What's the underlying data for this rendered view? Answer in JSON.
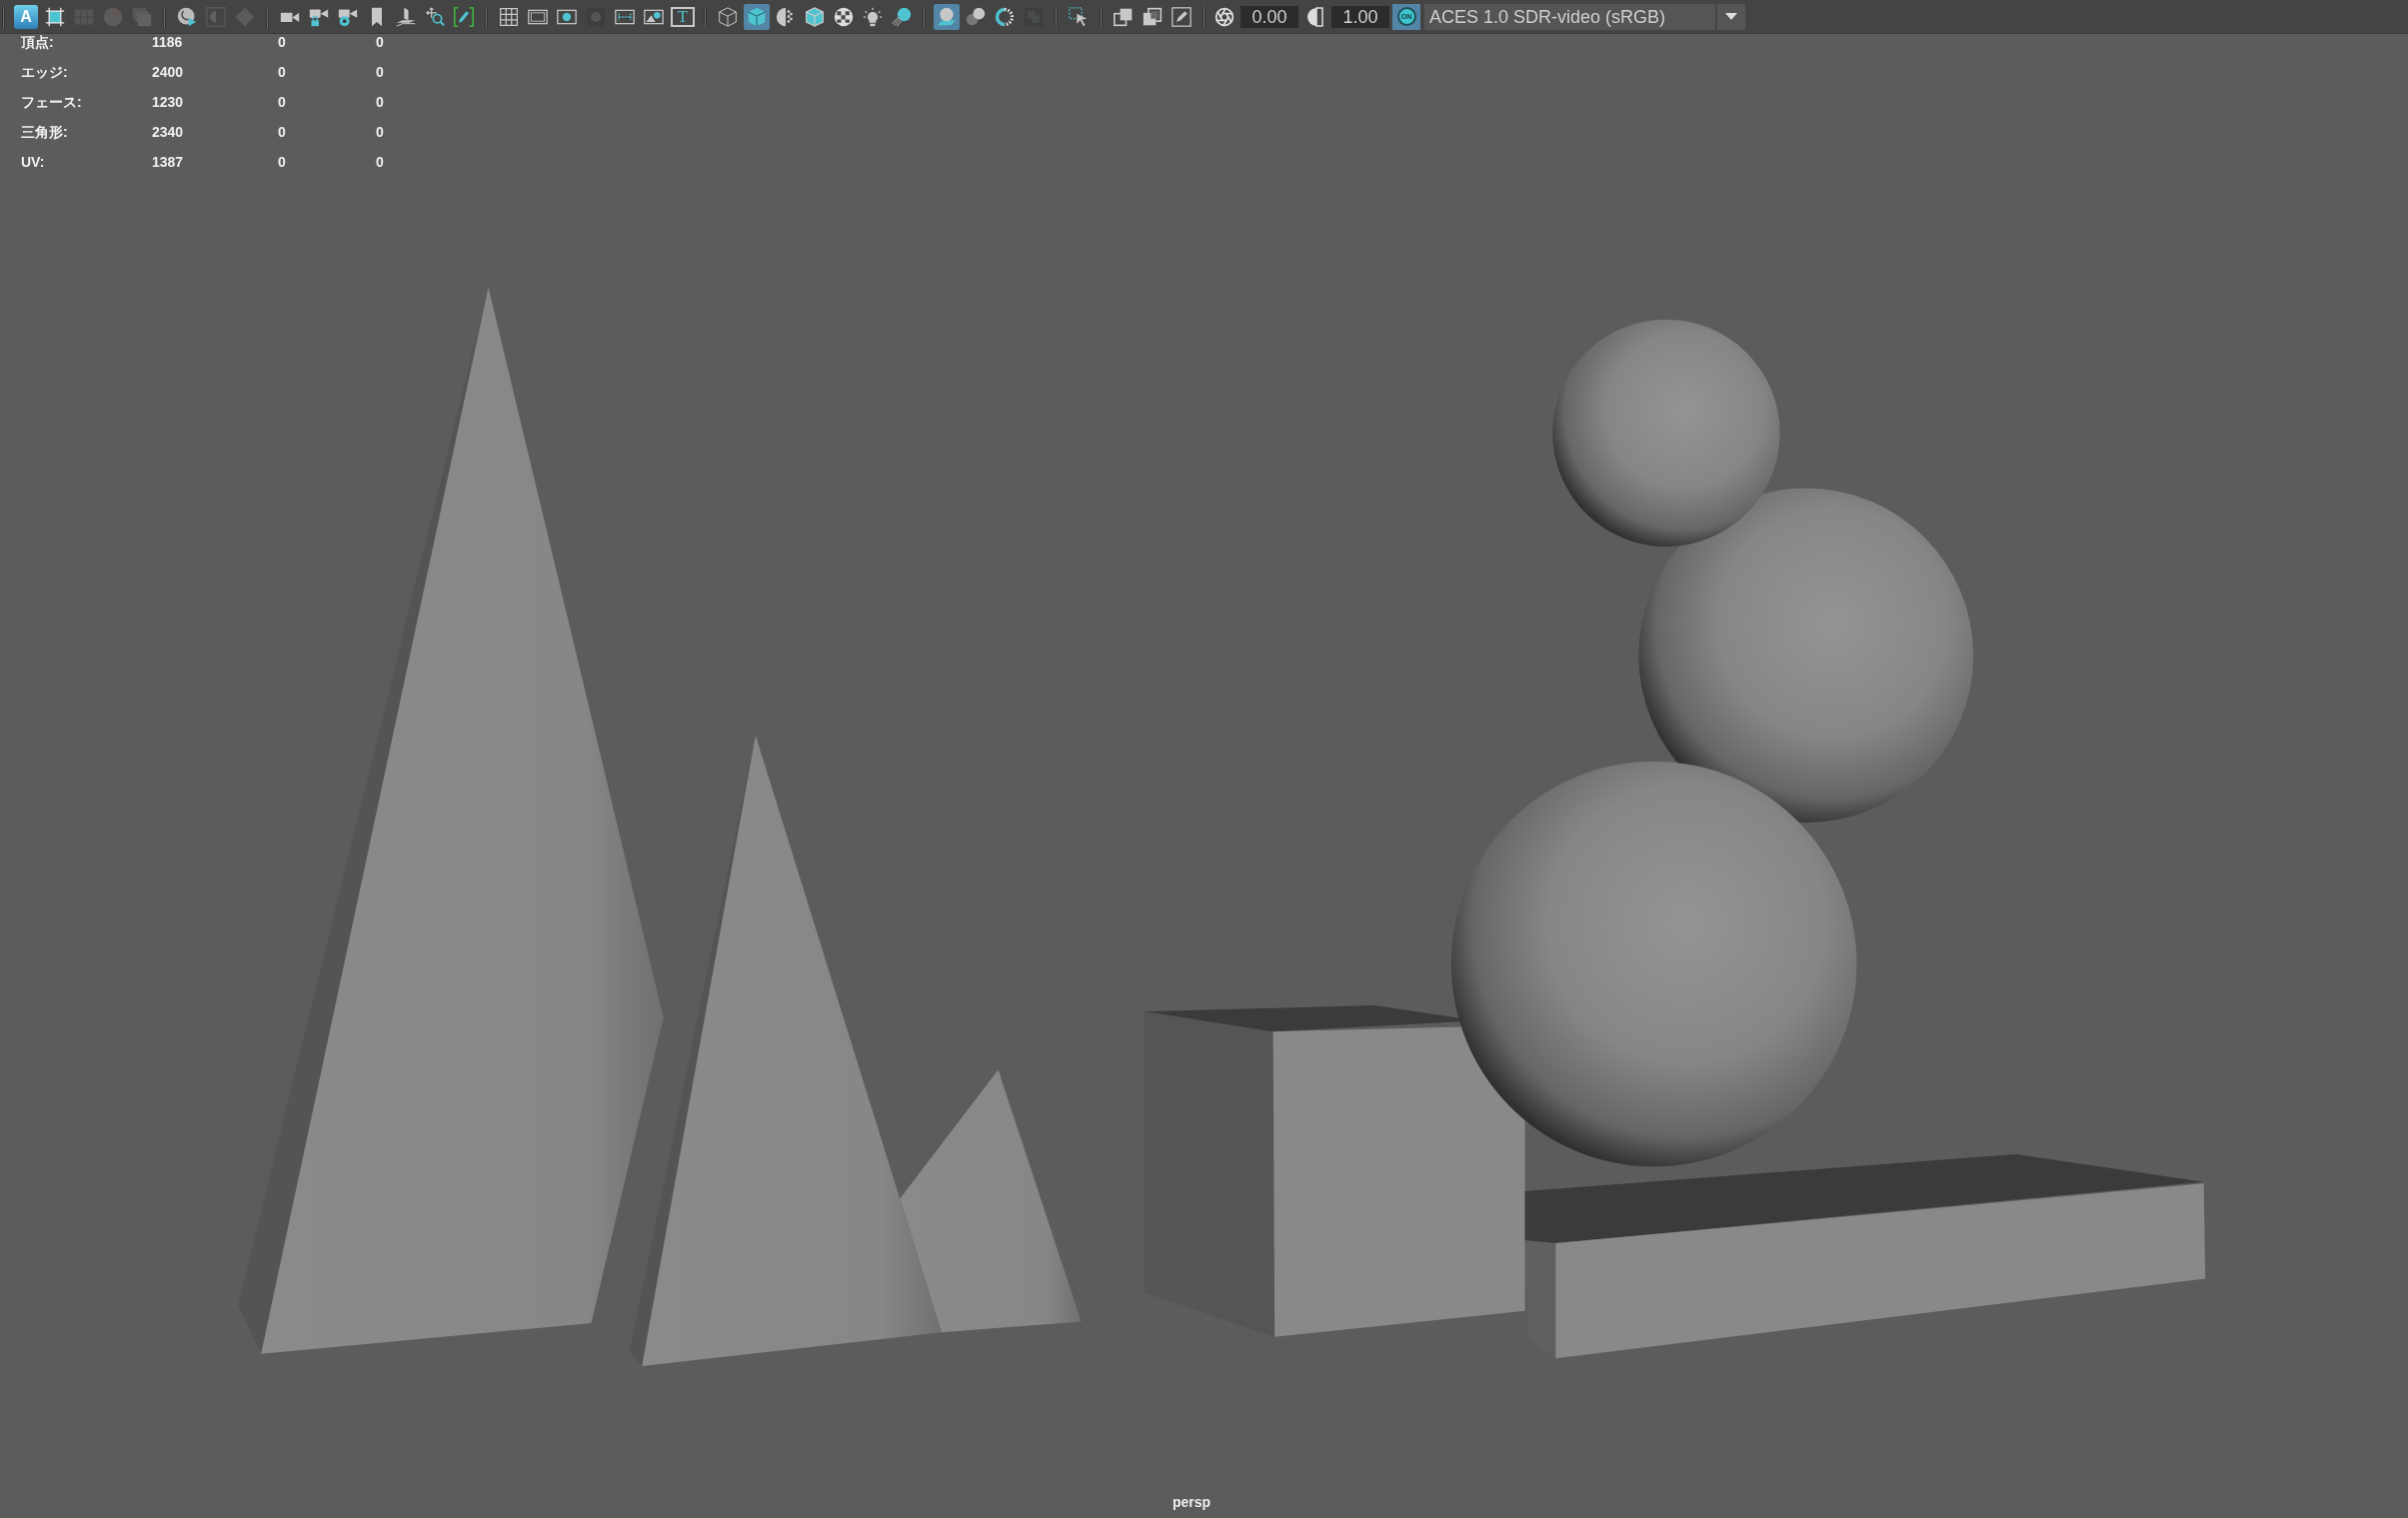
{
  "toolbar": {
    "groups": [
      {
        "buttons": [
          {
            "label": "A",
            "pressed": false,
            "disabled": false
          },
          {
            "pressed": false,
            "disabled": false
          },
          {
            "pressed": false,
            "disabled": true
          },
          {
            "pressed": false,
            "disabled": true
          },
          {
            "pressed": false,
            "disabled": true
          }
        ]
      },
      {
        "buttons": [
          {
            "pressed": false,
            "disabled": false
          },
          {
            "pressed": false,
            "disabled": true
          },
          {
            "pressed": false,
            "disabled": true
          }
        ]
      },
      {
        "buttons": [
          {
            "pressed": false,
            "disabled": false
          },
          {
            "pressed": false,
            "disabled": false
          },
          {
            "pressed": false,
            "disabled": false
          },
          {
            "pressed": false,
            "disabled": false
          },
          {
            "pressed": false,
            "disabled": false
          },
          {
            "pressed": false,
            "disabled": false
          },
          {
            "pressed": false,
            "disabled": false
          }
        ]
      },
      {
        "buttons": [
          {
            "pressed": false,
            "disabled": false
          },
          {
            "pressed": false,
            "disabled": false
          },
          {
            "pressed": false,
            "disabled": false
          },
          {
            "pressed": false,
            "disabled": true
          },
          {
            "pressed": false,
            "disabled": false
          },
          {
            "pressed": false,
            "disabled": false
          },
          {
            "label": "T",
            "pressed": false,
            "disabled": false
          }
        ]
      },
      {
        "buttons": [
          {
            "pressed": false,
            "disabled": false
          },
          {
            "pressed": true,
            "disabled": false
          },
          {
            "pressed": false,
            "disabled": false
          },
          {
            "pressed": false,
            "disabled": false
          },
          {
            "pressed": false,
            "disabled": false
          },
          {
            "pressed": false,
            "disabled": false
          },
          {
            "pressed": false,
            "disabled": false
          }
        ]
      },
      {
        "buttons": [
          {
            "pressed": true,
            "disabled": false
          },
          {
            "pressed": false,
            "disabled": false
          },
          {
            "pressed": false,
            "disabled": false
          },
          {
            "pressed": false,
            "disabled": true
          }
        ]
      },
      {
        "buttons": [
          {
            "pressed": false,
            "disabled": false
          }
        ]
      },
      {
        "buttons": [
          {
            "pressed": false,
            "disabled": false
          },
          {
            "pressed": false,
            "disabled": false
          },
          {
            "pressed": false,
            "disabled": false
          }
        ]
      }
    ],
    "exposure": {
      "value": "0.00"
    },
    "gamma": {
      "value": "1.00"
    },
    "color_management": {
      "label": "ON",
      "on": true
    },
    "view_transform": {
      "value": "ACES 1.0 SDR-video (sRGB)"
    }
  },
  "hud": {
    "rows": [
      {
        "label": "頂点:",
        "values": [
          "1186",
          "0",
          "0"
        ]
      },
      {
        "label": "エッジ:",
        "values": [
          "2400",
          "0",
          "0"
        ]
      },
      {
        "label": "フェース:",
        "values": [
          "1230",
          "0",
          "0"
        ]
      },
      {
        "label": "三角形:",
        "values": [
          "2340",
          "0",
          "0"
        ]
      },
      {
        "label": "UV:",
        "values": [
          "1387",
          "0",
          "0"
        ]
      }
    ]
  },
  "viewport": {
    "camera": "persp"
  }
}
